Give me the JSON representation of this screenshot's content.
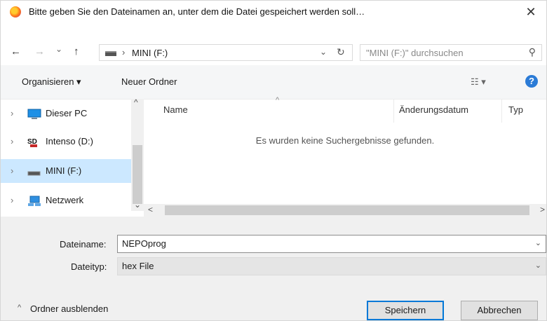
{
  "dialog": {
    "title": "Bitte geben Sie den Dateinamen an, unter dem die Datei gespeichert werden soll…",
    "close_glyph": "✕"
  },
  "navigation": {
    "back_glyph": "←",
    "forward_glyph": "→",
    "recent_glyph": "⌄",
    "up_glyph": "↑",
    "breadcrumb_separator": "›",
    "address_location": "MINI (F:)",
    "address_dropdown_glyph": "⌄",
    "refresh_glyph": "↻",
    "search_placeholder": "\"MINI (F:)\" durchsuchen",
    "search_glyph": "⚲"
  },
  "toolbar": {
    "organize_label": "Organisieren ▾",
    "new_folder_label": "Neuer Ordner",
    "view_glyph": "☷ ▾",
    "help_glyph": "?"
  },
  "nav_pane": {
    "items": [
      {
        "label": "Dieser PC",
        "selected": false,
        "icon": "computer-icon"
      },
      {
        "label": "Intenso (D:)",
        "selected": false,
        "icon": "sd-card-icon"
      },
      {
        "label": "MINI (F:)",
        "selected": true,
        "icon": "drive-icon"
      },
      {
        "label": "Netzwerk",
        "selected": false,
        "icon": "network-icon"
      }
    ],
    "expander_glyph": "›"
  },
  "file_list": {
    "columns": [
      "Name",
      "Änderungsdatum",
      "Typ"
    ],
    "sort_glyph": "^",
    "empty_message": "Es wurden keine Suchergebnisse gefunden."
  },
  "scroll": {
    "up_glyph": "^",
    "down_glyph": "⌄",
    "left_glyph": "<",
    "right_glyph": ">"
  },
  "form": {
    "filename_label": "Dateiname:",
    "filename_value": "NEPOprog",
    "filetype_label": "Dateityp:",
    "filetype_value": "hex File",
    "dropdown_glyph": "⌄"
  },
  "footer": {
    "hide_folders_glyph": "^",
    "hide_folders_label": "Ordner ausblenden",
    "save_label": "Speichern",
    "cancel_label": "Abbrechen"
  },
  "colors": {
    "selection": "#cce8ff",
    "accent": "#0078d7",
    "help": "#2b7bd6"
  }
}
